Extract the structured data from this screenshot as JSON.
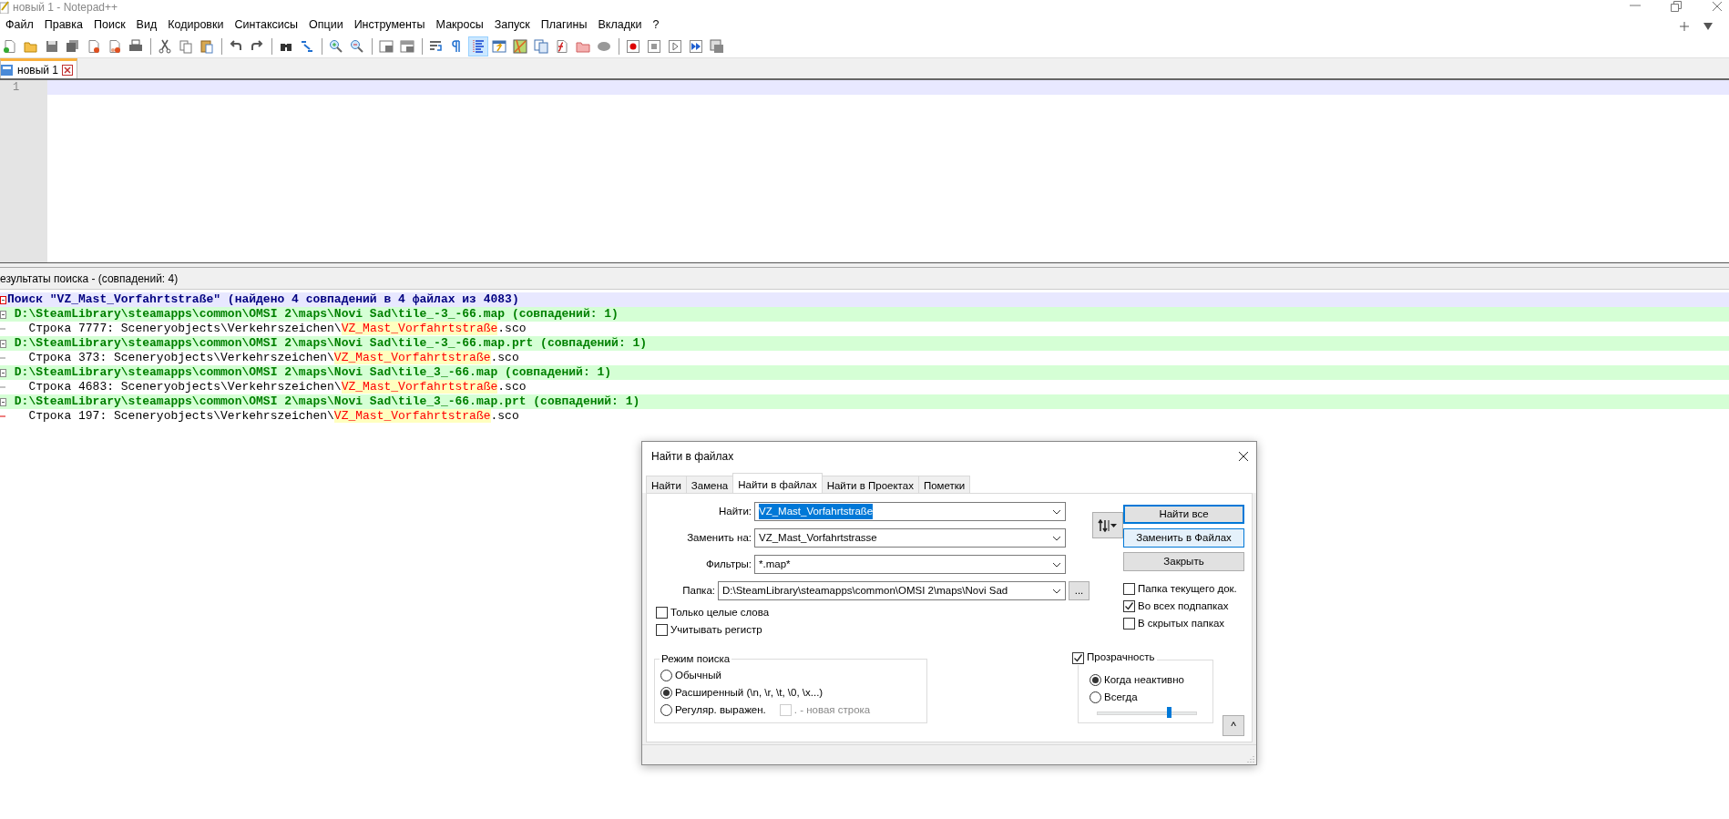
{
  "window": {
    "title": "новый 1 - Notepad++"
  },
  "menu": [
    "Файл",
    "Правка",
    "Поиск",
    "Вид",
    "Кодировки",
    "Синтаксисы",
    "Опции",
    "Инструменты",
    "Макросы",
    "Запуск",
    "Плагины",
    "Вкладки",
    "?"
  ],
  "toolbar": [
    {
      "pressed": false
    },
    {
      "pressed": false
    },
    {
      "pressed": false
    },
    {
      "pressed": false
    },
    {
      "pressed": false
    },
    {
      "pressed": false
    },
    {
      "pressed": false
    },
    {
      "pressed": false
    },
    {
      "pressed": false
    },
    {
      "pressed": false
    },
    {
      "pressed": false
    },
    {
      "pressed": false
    },
    {
      "pressed": false
    },
    {
      "pressed": false
    },
    {
      "pressed": false
    },
    {
      "pressed": false
    },
    {
      "pressed": false
    },
    {
      "pressed": false
    },
    {
      "pressed": false
    },
    {
      "pressed": false
    },
    {
      "pressed": true
    },
    {
      "pressed": false
    },
    {
      "pressed": false
    },
    {
      "pressed": false
    },
    {
      "pressed": false
    },
    {
      "pressed": false
    },
    {
      "pressed": false
    },
    {
      "pressed": false
    },
    {
      "pressed": false
    },
    {
      "pressed": false
    },
    {
      "pressed": false
    },
    {
      "pressed": false
    }
  ],
  "tabs": [
    {
      "label": "новый 1",
      "selected": true
    }
  ],
  "editor": {
    "line_numbers": [
      "1"
    ]
  },
  "results": {
    "title": "езультаты поиска - (совпадений: 4)",
    "lines": [
      {
        "kind": "search",
        "text": "Поиск \"VZ_Mast_Vorfahrtstraße\" (найдено 4 совпадений в 4 файлах из 4083)"
      },
      {
        "kind": "file",
        "text": "D:\\SteamLibrary\\steamapps\\common\\OMSI 2\\maps\\Novi Sad\\tile_-3_-66.map (совпадений: 1)"
      },
      {
        "kind": "hit",
        "prefix": "Строка 7777: Sceneryobjects\\Verkehrszeichen\\",
        "match": "VZ_Mast_Vorfahrtstraße",
        "suffix": ".sco"
      },
      {
        "kind": "file",
        "text": "D:\\SteamLibrary\\steamapps\\common\\OMSI 2\\maps\\Novi Sad\\tile_-3_-66.map.prt (совпадений: 1)"
      },
      {
        "kind": "hit",
        "prefix": "Строка 373: Sceneryobjects\\Verkehrszeichen\\",
        "match": "VZ_Mast_Vorfahrtstraße",
        "suffix": ".sco"
      },
      {
        "kind": "file",
        "text": "D:\\SteamLibrary\\steamapps\\common\\OMSI 2\\maps\\Novi Sad\\tile_3_-66.map (совпадений: 1)"
      },
      {
        "kind": "hit",
        "prefix": "Строка 4683: Sceneryobjects\\Verkehrszeichen\\",
        "match": "VZ_Mast_Vorfahrtstraße",
        "suffix": ".sco"
      },
      {
        "kind": "file",
        "text": "D:\\SteamLibrary\\steamapps\\common\\OMSI 2\\maps\\Novi Sad\\tile_3_-66.map.prt (совпадений: 1)"
      },
      {
        "kind": "hit",
        "prefix": "Строка 197: Sceneryobjects\\Verkehrszeichen\\",
        "match": "VZ_Mast_Vorfahrtstraße",
        "suffix": ".sco"
      }
    ]
  },
  "dialog": {
    "title": "Найти в файлах",
    "tabs": [
      {
        "label": "Найти",
        "selected": false
      },
      {
        "label": "Замена",
        "selected": false
      },
      {
        "label": "Найти в файлах",
        "selected": true
      },
      {
        "label": "Найти в Проектах",
        "selected": false
      },
      {
        "label": "Пометки",
        "selected": false
      }
    ],
    "fields": [
      {
        "label": "Найти:",
        "value": "VZ_Mast_Vorfahrtstraße",
        "text_selected": true
      },
      {
        "label": "Заменить на:",
        "value": "VZ_Mast_Vorfahrtstrasse",
        "text_selected": false
      },
      {
        "label": "Фильтры:",
        "value": "*.map*",
        "text_selected": false
      }
    ],
    "folder": {
      "label": "Папка:",
      "value": "D:\\SteamLibrary\\steamapps\\common\\OMSI 2\\maps\\Novi Sad",
      "browse": "..."
    },
    "buttons": [
      {
        "label": "Найти все",
        "kind": "default"
      },
      {
        "label": "Заменить в Файлах",
        "kind": "hover"
      },
      {
        "label": "Закрыть",
        "kind": "normal"
      }
    ],
    "folder_options": [
      {
        "label": "Папка текущего док.",
        "checked": false
      },
      {
        "label": "Во всех подпапках",
        "checked": true
      },
      {
        "label": "В скрытых папках",
        "checked": false
      }
    ],
    "match_options": [
      {
        "label": "Только целые слова",
        "checked": false
      },
      {
        "label": "Учитывать регистр",
        "checked": false
      }
    ],
    "search_mode": {
      "title": "Режим поиска",
      "options": [
        {
          "label": "Обычный",
          "selected": false
        },
        {
          "label": "Расширенный (\\n, \\r, \\t, \\0, \\x...)",
          "selected": true
        },
        {
          "label": "Регуляр. выражен.",
          "selected": false
        }
      ],
      "dot_newline": {
        "label": ". - новая строка",
        "checked": false,
        "disabled": true
      }
    },
    "transparency": {
      "label": "Прозрачность",
      "checked": true,
      "options": [
        {
          "label": "Когда неактивно",
          "selected": true
        },
        {
          "label": "Всегда",
          "selected": false
        }
      ],
      "level": 0.72
    },
    "collapse": "^"
  }
}
